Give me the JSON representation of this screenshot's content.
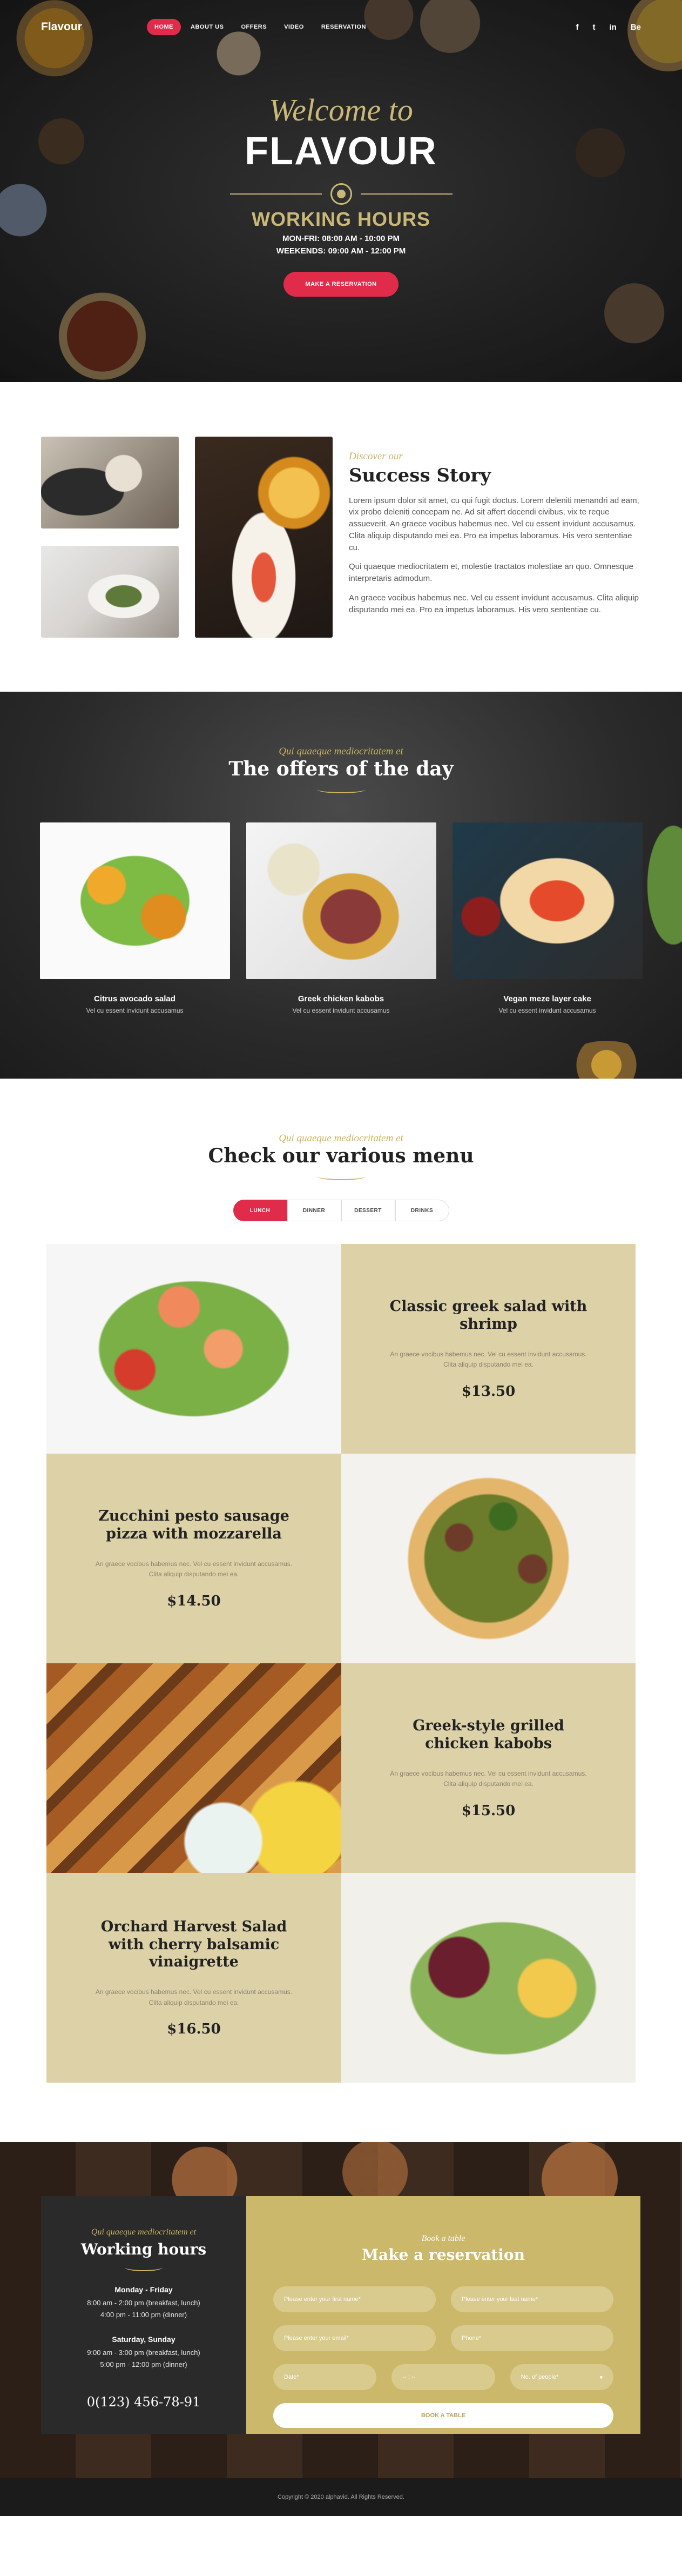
{
  "nav": {
    "logo": "Flavour",
    "links": [
      {
        "label": "Home",
        "active": true
      },
      {
        "label": "About us",
        "active": false
      },
      {
        "label": "Offers",
        "active": false
      },
      {
        "label": "Video",
        "active": false
      },
      {
        "label": "Reservation",
        "active": false
      }
    ],
    "socials": [
      "f",
      "t",
      "in",
      "Be"
    ]
  },
  "hero": {
    "welcome": "Welcome to",
    "brand": "FLAVOUR",
    "hours_title": "WORKING HOURS",
    "hours_line1": "MON-FRI: 08:00 AM - 10:00 PM",
    "hours_line2": "WEEKENDS: 09:00 AM - 12:00 PM",
    "button": "Make a reservation"
  },
  "story": {
    "discover": "Discover our",
    "title": "Success Story",
    "p1": "Lorem ipsum dolor sit amet, cu qui fugit doctus. Lorem deleniti menandri ad eam, vix probo deleniti concepam ne. Ad sit affert docendi civibus, vix te reque assueverit. An graece vocibus habemus nec. Vel cu essent invidunt accusamus.",
    "p1b": "Clita aliquip disputando mei ea. Pro ea impetus laboramus. His vero sententiae cu.",
    "p2": "Qui quaeque mediocritatem et, molestie tractatos molestiae an quo. Omnesque interpretaris admodum.",
    "p3": "An graece vocibus habemus nec. Vel cu essent invidunt accusamus. Clita aliquip disputando mei ea. Pro ea impetus laboramus. His vero sententiae cu."
  },
  "offers": {
    "sub": "Qui quaeque mediocritatem et",
    "title": "The offers of the day",
    "items": [
      {
        "name": "Citrus avocado salad",
        "desc": "Vel cu essent invidunt accusamus"
      },
      {
        "name": "Greek chicken kabobs",
        "desc": "Vel cu essent invidunt accusamus"
      },
      {
        "name": "Vegan meze layer cake",
        "desc": "Vel cu essent invidunt accusamus"
      }
    ]
  },
  "menu": {
    "sub": "Qui quaeque mediocritatem et",
    "title": "Check our various menu",
    "tabs": [
      {
        "label": "Lunch",
        "active": true
      },
      {
        "label": "Dinner",
        "active": false
      },
      {
        "label": "Dessert",
        "active": false
      },
      {
        "label": "Drinks",
        "active": false
      }
    ],
    "dishes": [
      {
        "name": "Classic greek salad with shrimp",
        "desc1": "An graece vocibus habemus nec. Vel cu essent invidunt accusamus.",
        "desc2": "Clita aliquip disputando mei ea.",
        "price": "$13.50"
      },
      {
        "name": "Zucchini pesto sausage pizza with mozzarella",
        "desc1": "An graece vocibus habemus nec. Vel cu essent invidunt accusamus.",
        "desc2": "Clita aliquip disputando mei ea.",
        "price": "$14.50"
      },
      {
        "name": "Greek-style grilled chicken kabobs",
        "desc1": "An graece vocibus habemus nec. Vel cu essent invidunt accusamus.",
        "desc2": "Clita aliquip disputando mei ea.",
        "price": "$15.50"
      },
      {
        "name": "Orchard Harvest Salad with cherry balsamic vinaigrette",
        "desc1": "An graece vocibus habemus nec. Vel cu essent invidunt accusamus.",
        "desc2": "Clita aliquip disputando mei ea.",
        "price": "$16.50"
      }
    ]
  },
  "reservation": {
    "hours_sub": "Qui quaeque mediocritatem et",
    "hours_title": "Working hours",
    "day1": "Monday - Friday",
    "day1_t1": "8:00 am - 2:00 pm (breakfast, lunch)",
    "day1_t2": "4:00 pm - 11:00 pm (dinner)",
    "day2": "Saturday, Sunday",
    "day2_t1": "9:00 am - 3:00 pm (breakfast, lunch)",
    "day2_t2": "5:00 pm - 12:00 pm (dinner)",
    "phone": "0(123) 456-78-91",
    "form_sub": "Book a table",
    "form_title": "Make a reservation",
    "ph_first": "Please enter your first name*",
    "ph_last": "Please enter your last name*",
    "ph_email": "Please enter your email*",
    "ph_phone": "Phone*",
    "ph_date": "Date*",
    "ph_time": "-- : --",
    "ph_persons": "No. of people*",
    "button": "Book a table"
  },
  "footer": {
    "copy": "Copyright © 2020 alphavid. All Rights Reserved."
  },
  "colors": {
    "accent": "#e02c4a",
    "gold": "#c9b35f",
    "menu_bg": "#ddd1a7"
  }
}
